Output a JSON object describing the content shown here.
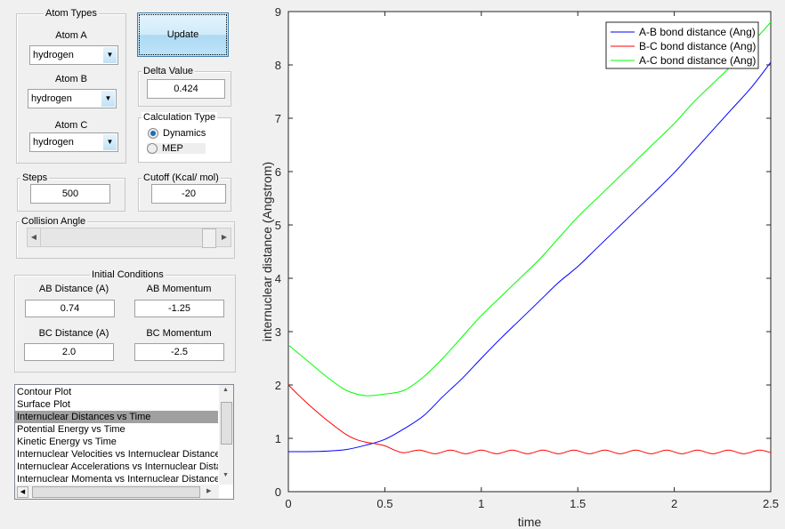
{
  "atom_types": {
    "title": "Atom Types",
    "atom_a_label": "Atom A",
    "atom_a": "hydrogen",
    "atom_b_label": "Atom B",
    "atom_b": "hydrogen",
    "atom_c_label": "Atom C",
    "atom_c": "hydrogen"
  },
  "update_label": "Update",
  "delta": {
    "title": "Delta Value",
    "value": "0.424"
  },
  "calc": {
    "title": "Calculation Type",
    "options": [
      "Dynamics",
      "MEP"
    ],
    "selected": "Dynamics"
  },
  "steps": {
    "title": "Steps",
    "value": "500"
  },
  "cutoff": {
    "title": "Cutoff (Kcal/ mol)",
    "value": "-20"
  },
  "collision": {
    "title": "Collision Angle",
    "slider_fraction": 1.0
  },
  "initial": {
    "title": "Initial Conditions",
    "ab_dist_label": "AB Distance (A)",
    "ab_dist": "0.74",
    "ab_mom_label": "AB Momentum",
    "ab_mom": "-1.25",
    "bc_dist_label": "BC Distance (A)",
    "bc_dist": "2.0",
    "bc_mom_label": "BC Momentum",
    "bc_mom": "-2.5"
  },
  "plot_list": {
    "items": [
      "Contour Plot",
      "Surface Plot",
      "Internuclear Distances vs Time",
      "Potential Energy vs Time",
      "Kinetic Energy vs Time",
      "Internuclear Velocities vs Internuclear Distance",
      "Internuclear Accelerations vs Internuclear Distance",
      "Internuclear Momenta vs Internuclear Distance"
    ],
    "selected_index": 2
  },
  "chart_data": {
    "type": "line",
    "xlabel": "time",
    "ylabel": "internuclear distance (Angstrom)",
    "xlim": [
      0,
      2.5
    ],
    "ylim": [
      0,
      9
    ],
    "xticks": [
      "0",
      "0.5",
      "1",
      "1.5",
      "2",
      "2.5"
    ],
    "yticks": [
      "0",
      "1",
      "2",
      "3",
      "4",
      "5",
      "6",
      "7",
      "8",
      "9"
    ],
    "grid": false,
    "legend_placement": "top-right",
    "series": [
      {
        "name": "A-B bond distance (Ang)",
        "color": "#0000ff",
        "x": [
          0,
          0.1,
          0.2,
          0.3,
          0.4,
          0.5,
          0.6,
          0.7,
          0.8,
          0.9,
          1.0,
          1.1,
          1.2,
          1.3,
          1.4,
          1.5,
          1.6,
          1.7,
          1.8,
          1.9,
          2.0,
          2.1,
          2.2,
          2.3,
          2.4,
          2.5
        ],
        "y": [
          0.75,
          0.75,
          0.76,
          0.79,
          0.87,
          0.98,
          1.18,
          1.42,
          1.78,
          2.12,
          2.5,
          2.87,
          3.22,
          3.57,
          3.92,
          4.22,
          4.57,
          4.92,
          5.27,
          5.62,
          5.98,
          6.38,
          6.78,
          7.18,
          7.58,
          8.05
        ]
      },
      {
        "name": "B-C bond distance (Ang)",
        "color": "#ff0000",
        "x": [
          0,
          0.05,
          0.1,
          0.15,
          0.2,
          0.25,
          0.3,
          0.35,
          0.4,
          0.45,
          0.5,
          0.55,
          0.6,
          0.68,
          0.76,
          0.84,
          0.92,
          1.0,
          1.08,
          1.16,
          1.24,
          1.32,
          1.4,
          1.48,
          1.56,
          1.64,
          1.72,
          1.8,
          1.88,
          1.96,
          2.04,
          2.12,
          2.2,
          2.28,
          2.36,
          2.44,
          2.5
        ],
        "y": [
          2.0,
          1.82,
          1.65,
          1.49,
          1.34,
          1.2,
          1.07,
          0.98,
          0.93,
          0.9,
          0.86,
          0.78,
          0.73,
          0.78,
          0.71,
          0.78,
          0.71,
          0.78,
          0.71,
          0.78,
          0.71,
          0.78,
          0.71,
          0.78,
          0.71,
          0.78,
          0.71,
          0.78,
          0.71,
          0.78,
          0.71,
          0.78,
          0.71,
          0.78,
          0.71,
          0.78,
          0.73
        ]
      },
      {
        "name": "A-C bond distance (Ang)",
        "color": "#00ff00",
        "x": [
          0,
          0.1,
          0.2,
          0.3,
          0.4,
          0.5,
          0.6,
          0.7,
          0.8,
          0.9,
          1.0,
          1.1,
          1.2,
          1.3,
          1.4,
          1.5,
          1.6,
          1.7,
          1.8,
          1.9,
          2.0,
          2.1,
          2.2,
          2.3,
          2.4,
          2.5
        ],
        "y": [
          2.75,
          2.45,
          2.15,
          1.9,
          1.8,
          1.83,
          1.9,
          2.15,
          2.5,
          2.9,
          3.3,
          3.65,
          4.0,
          4.35,
          4.75,
          5.15,
          5.5,
          5.85,
          6.2,
          6.55,
          6.9,
          7.3,
          7.65,
          8.0,
          8.4,
          8.8
        ]
      }
    ]
  }
}
